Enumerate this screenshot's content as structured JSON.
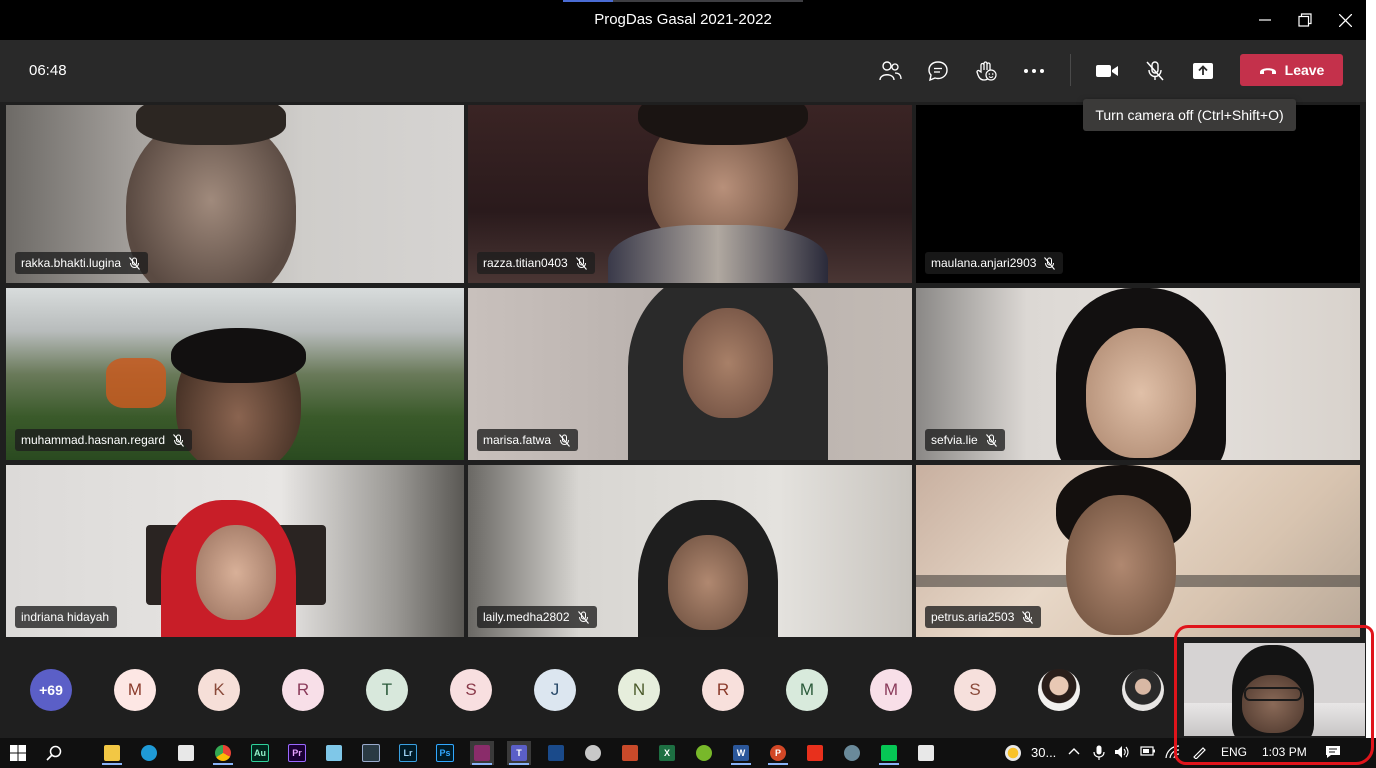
{
  "window": {
    "title": "ProgDas Gasal 2021-2022"
  },
  "toolbar": {
    "timer": "06:48",
    "leave_label": "Leave",
    "tooltip": "Turn camera off (Ctrl+Shift+O)",
    "buttons": [
      "people-icon",
      "chat-icon",
      "raise-hand-icon",
      "more-options-icon",
      "camera-icon",
      "mic-off-icon",
      "share-tray-icon"
    ]
  },
  "participants": [
    {
      "name": "rakka.bhakti.lugina",
      "muted": true
    },
    {
      "name": "razza.titian0403",
      "muted": true
    },
    {
      "name": "maulana.anjari2903",
      "muted": true
    },
    {
      "name": "muhammad.hasnan.regard",
      "muted": true
    },
    {
      "name": "marisa.fatwa",
      "muted": true
    },
    {
      "name": "sefvia.lie",
      "muted": true
    },
    {
      "name": "indriana hidayah",
      "muted": false
    },
    {
      "name": "laily.medha2802",
      "muted": true
    },
    {
      "name": "petrus.aria2503",
      "muted": true
    }
  ],
  "overflow": {
    "count_label": "+69",
    "initials": [
      "M",
      "K",
      "R",
      "T",
      "S",
      "J",
      "N",
      "R",
      "M",
      "M",
      "S"
    ]
  },
  "taskbar": {
    "weather": "30...",
    "language": "ENG",
    "time": "1:03 PM"
  },
  "colors": {
    "leave": "#c4314b",
    "annotation": "#e0141b",
    "overflow_badge": "#5b5fc7"
  }
}
